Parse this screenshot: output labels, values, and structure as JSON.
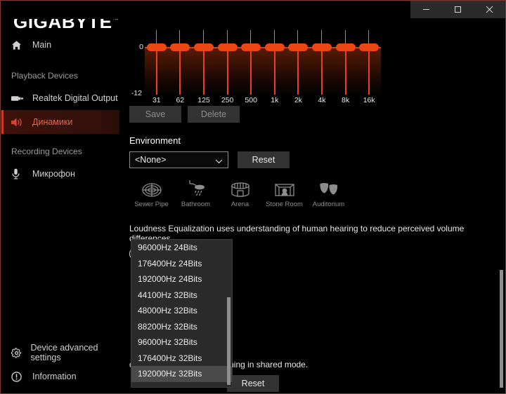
{
  "window": {
    "titlebar": {
      "minimize_label": "Minimize",
      "maximize_label": "Maximize",
      "close_label": "Close"
    }
  },
  "brand": {
    "logo": "GIGABYTE",
    "trademark": "™"
  },
  "sidebar": {
    "main_item": {
      "label": "Main",
      "icon": "home-icon"
    },
    "playback_group_label": "Playback Devices",
    "playback_items": [
      {
        "label": "Realtek Digital Output",
        "icon": "spdif-icon",
        "active": false
      },
      {
        "label": "Динамики",
        "icon": "speaker-icon",
        "active": true
      }
    ],
    "recording_group_label": "Recording Devices",
    "recording_items": [
      {
        "label": "Микрофон",
        "icon": "microphone-icon",
        "active": false
      }
    ],
    "bottom_items": [
      {
        "label": "Device advanced settings",
        "icon": "gear-icon"
      },
      {
        "label": "Information",
        "icon": "info-icon"
      }
    ]
  },
  "equalizer": {
    "y_top_label": "0",
    "y_bottom_label": "-12",
    "bands": [
      {
        "freq": "31",
        "value": 0
      },
      {
        "freq": "62",
        "value": 0
      },
      {
        "freq": "125",
        "value": 0
      },
      {
        "freq": "250",
        "value": 0
      },
      {
        "freq": "500",
        "value": 0
      },
      {
        "freq": "1k",
        "value": 0
      },
      {
        "freq": "2k",
        "value": 0
      },
      {
        "freq": "4k",
        "value": 0
      },
      {
        "freq": "8k",
        "value": 0
      },
      {
        "freq": "16k",
        "value": 0
      }
    ],
    "save_label": "Save",
    "delete_label": "Delete"
  },
  "environment": {
    "title": "Environment",
    "selected": "<None>",
    "reset_label": "Reset",
    "presets": [
      {
        "label": "Sewer Pipe",
        "icon": "sewer-pipe-icon"
      },
      {
        "label": "Bathroom",
        "icon": "shower-icon"
      },
      {
        "label": "Arena",
        "icon": "arena-icon"
      },
      {
        "label": "Stone Room",
        "icon": "stone-room-icon"
      },
      {
        "label": "Auditorium",
        "icon": "theater-masks-icon"
      }
    ]
  },
  "loudness": {
    "description": "Loudness Equalization uses understanding of human hearing to reduce perceived volume differences.",
    "toggle_state": "Off"
  },
  "default_format": {
    "description_visible": "depth to be used when running in shared mode.",
    "reset_label": "Reset",
    "options": [
      "96000Hz 24Bits",
      "176400Hz 24Bits",
      "192000Hz 24Bits",
      "44100Hz 32Bits",
      "48000Hz 32Bits",
      "88200Hz 32Bits",
      "96000Hz 32Bits",
      "176400Hz 32Bits",
      "192000Hz 32Bits"
    ],
    "selected": "192000Hz 32Bits"
  },
  "colors": {
    "accent": "#cf3b18",
    "eq_slider": "#ec4613",
    "window_border": "#7a3b33",
    "background": "#000000"
  }
}
